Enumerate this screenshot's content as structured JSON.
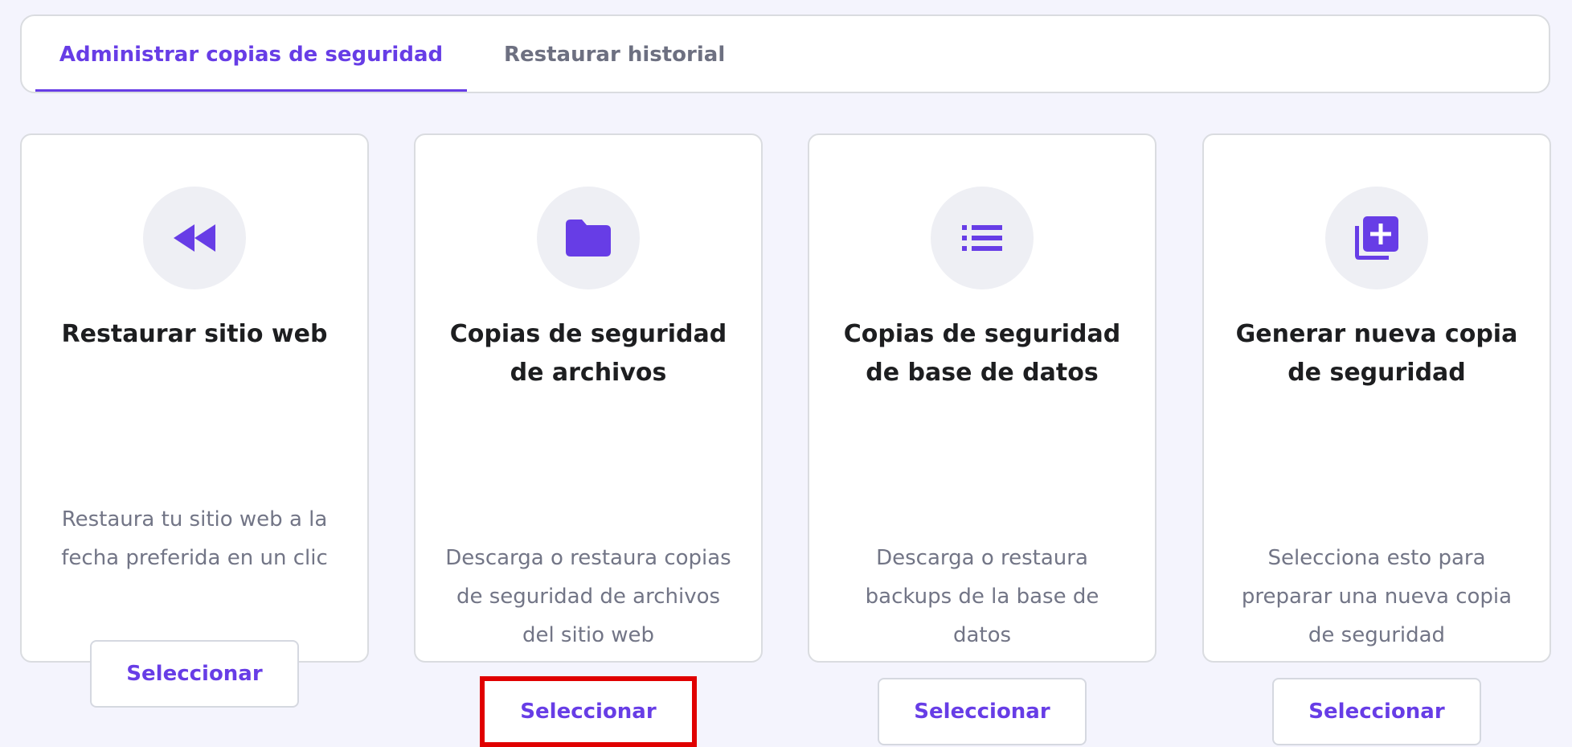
{
  "tabs": [
    {
      "label": "Administrar copias de seguridad",
      "active": true
    },
    {
      "label": "Restaurar historial",
      "active": false
    }
  ],
  "accent_color": "#673de6",
  "highlight_color": "#e00000",
  "cards": [
    {
      "icon": "rewind-icon",
      "title": "Restaurar sitio web",
      "description": "Restaura tu sitio web a la fecha preferida en un clic",
      "button_label": "Seleccionar"
    },
    {
      "icon": "folder-icon",
      "title": "Copias de seguridad de archivos",
      "description": "Descarga o restaura copias de seguridad de archivos del sitio web",
      "button_label": "Seleccionar"
    },
    {
      "icon": "list-icon",
      "title": "Copias de seguridad de base de datos",
      "description": "Descarga o restaura backups de la base de datos",
      "button_label": "Seleccionar"
    },
    {
      "icon": "add-copy-icon",
      "title": "Generar nueva copia de seguridad",
      "description": "Selecciona esto para preparar una nueva copia de seguridad",
      "button_label": "Seleccionar"
    }
  ]
}
